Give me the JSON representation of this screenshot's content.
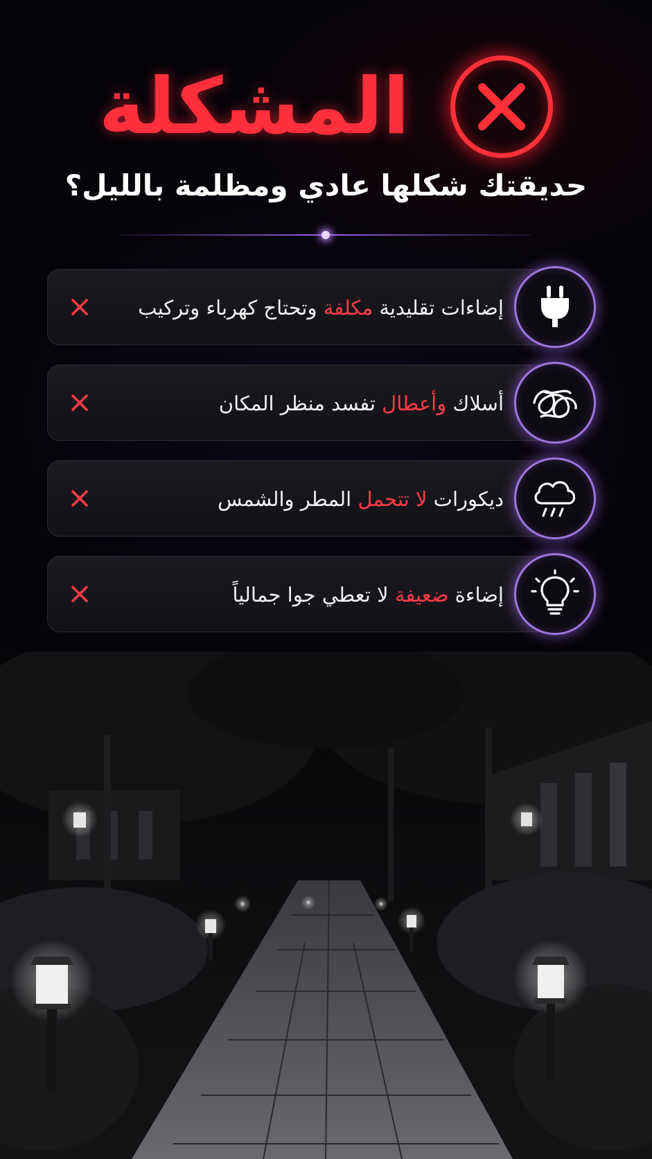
{
  "header": {
    "title": "المشكلة",
    "subtitle": "حديقتك شكلها عادي ومظلمة بالليل؟",
    "accent_color": "#ff2f3c",
    "icon": "close-circle-icon"
  },
  "problems": [
    {
      "icon": "plug-icon",
      "text_before": "إضاءات تقليدية ",
      "highlight": "مكلفة",
      "text_after": " وتحتاج كهرباء وتركيب",
      "mark": "✕"
    },
    {
      "icon": "tangled-wires-icon",
      "text_before": "أسلاك ",
      "highlight": "وأعطال",
      "text_after": " تفسد منظر المكان",
      "mark": "✕"
    },
    {
      "icon": "rain-cloud-icon",
      "text_before": "ديكورات ",
      "highlight": "لا تتحمل",
      "text_after": " المطر والشمس",
      "mark": "✕"
    },
    {
      "icon": "lightbulb-icon",
      "text_before": "إضاءة ",
      "highlight": "ضعيفة",
      "text_after": " لا تعطي جوا جمالياً",
      "mark": "✕"
    }
  ],
  "colors": {
    "highlight": "#ff3c48",
    "icon_ring": "#a275e0",
    "background": "#050409"
  },
  "photo": {
    "subject": "night-garden-path-photo"
  }
}
